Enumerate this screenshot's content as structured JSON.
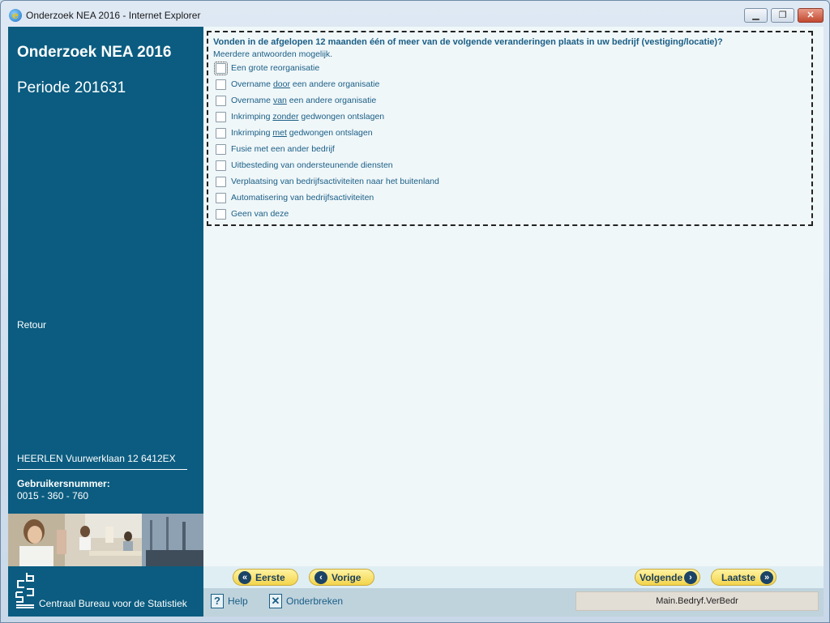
{
  "window": {
    "title": "Onderzoek NEA 2016 - Internet Explorer",
    "icon": "internet-explorer-icon",
    "minimize_label": "▁",
    "maximize_label": "❐",
    "close_label": "✕"
  },
  "sidebar": {
    "title": "Onderzoek NEA 2016",
    "period": "Periode 201631",
    "retour": "Retour",
    "address": "HEERLEN Vuurwerklaan 12 6412EX",
    "user_label": "Gebruikersnummer:",
    "user_number": "0015 - 360 - 760",
    "org_name": "Centraal Bureau voor de Statistiek",
    "background_color": "#0b5c80"
  },
  "question": {
    "title": "Vonden in de afgelopen 12 maanden één of meer van de volgende veranderingen plaats in uw bedrijf (vestiging/locatie)?",
    "subtitle": "Meerdere antwoorden mogelijk.",
    "options": [
      {
        "pre": "Een grote reorganisatie",
        "u": "",
        "post": "",
        "checked": false
      },
      {
        "pre": "Overname ",
        "u": "door",
        "post": " een andere organisatie",
        "checked": false
      },
      {
        "pre": "Overname ",
        "u": "van",
        "post": " een andere organisatie",
        "checked": false
      },
      {
        "pre": "Inkrimping ",
        "u": "zonder",
        "post": " gedwongen ontslagen",
        "checked": false
      },
      {
        "pre": "Inkrimping ",
        "u": "met",
        "post": " gedwongen ontslagen",
        "checked": false
      },
      {
        "pre": "Fusie met een ander bedrijf",
        "u": "",
        "post": "",
        "checked": false
      },
      {
        "pre": "Uitbesteding van ondersteunende diensten",
        "u": "",
        "post": "",
        "checked": false
      },
      {
        "pre": "Verplaatsing van bedrijfsactiviteiten naar het buitenland",
        "u": "",
        "post": "",
        "checked": false
      },
      {
        "pre": "Automatisering van bedrijfsactiviteiten",
        "u": "",
        "post": "",
        "checked": false
      },
      {
        "pre": "Geen van deze",
        "u": "",
        "post": "",
        "checked": false
      }
    ]
  },
  "navigation": {
    "first": "Eerste",
    "previous": "Vorige",
    "next": "Volgende",
    "last": "Laatste"
  },
  "footer": {
    "help": "Help",
    "cancel": "Onderbreken",
    "status": "Main.Bedryf.VerBedr"
  },
  "colors": {
    "accent_text": "#1a5e86",
    "nav_button": "#f3d44c",
    "content_bg": "#f0f7f9"
  }
}
